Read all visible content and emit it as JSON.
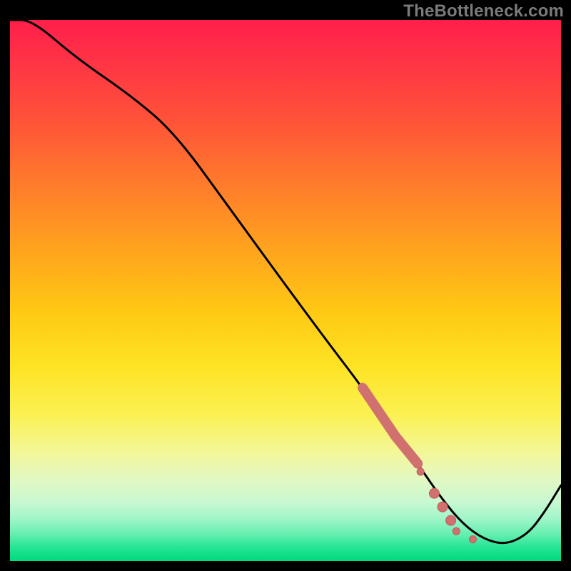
{
  "watermark": "TheBottleneck.com",
  "colors": {
    "curve": "#000000",
    "marker_stroke": "#c25b5b",
    "marker_fill": "#d0706f",
    "gradient_top": "#ff1f4b",
    "gradient_bottom": "#00d97c"
  },
  "chart_data": {
    "type": "line",
    "title": "",
    "xlabel": "",
    "ylabel": "",
    "xlim": [
      0,
      100
    ],
    "ylim": [
      0,
      100
    ],
    "series": [
      {
        "name": "curve",
        "x": [
          0,
          4,
          12,
          22,
          30,
          40,
          50,
          58,
          64,
          70,
          74,
          78,
          82,
          86,
          90,
          94,
          97,
          100
        ],
        "y": [
          100,
          100,
          93,
          86,
          79,
          65,
          51,
          40,
          32,
          23,
          18,
          12,
          7,
          4,
          3,
          5,
          9,
          14
        ]
      }
    ],
    "highlight_segment": {
      "name": "thick-highlight",
      "x": [
        64,
        70,
        74
      ],
      "y": [
        32,
        23,
        18
      ]
    },
    "markers": [
      {
        "x": 74.5,
        "y": 16.5,
        "r": 5
      },
      {
        "x": 77.0,
        "y": 12.5,
        "r": 7
      },
      {
        "x": 78.5,
        "y": 10.0,
        "r": 7
      },
      {
        "x": 80.0,
        "y": 7.5,
        "r": 7
      },
      {
        "x": 81.0,
        "y": 5.5,
        "r": 5
      },
      {
        "x": 84.0,
        "y": 4.0,
        "r": 5
      }
    ]
  }
}
